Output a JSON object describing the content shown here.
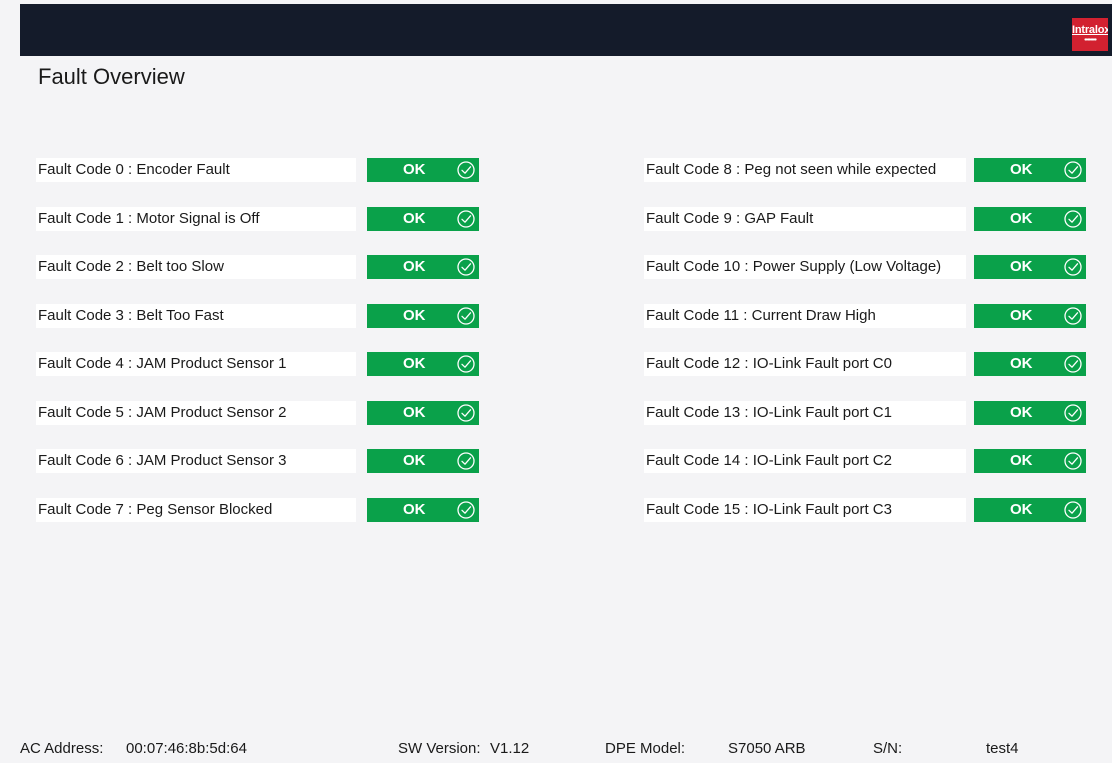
{
  "header": {
    "brand": "Intralox",
    "brand_color": "#d22130",
    "bar_color": "#141b2a"
  },
  "page": {
    "title": "Fault Overview"
  },
  "status_color": "#0aa14a",
  "status_icon": "check-circle-icon",
  "faults_left": [
    {
      "label": "Fault Code 0 : Encoder Fault",
      "status": "OK"
    },
    {
      "label": "Fault Code 1 : Motor Signal is Off",
      "status": "OK"
    },
    {
      "label": "Fault Code 2 : Belt too Slow",
      "status": "OK"
    },
    {
      "label": "Fault Code 3 : Belt Too Fast",
      "status": "OK"
    },
    {
      "label": "Fault Code 4 : JAM Product Sensor 1",
      "status": "OK"
    },
    {
      "label": "Fault Code 5 : JAM Product Sensor 2",
      "status": "OK"
    },
    {
      "label": "Fault Code 6 : JAM Product Sensor 3",
      "status": "OK"
    },
    {
      "label": "Fault Code 7 : Peg Sensor Blocked",
      "status": "OK"
    }
  ],
  "faults_right": [
    {
      "label": "Fault Code 8 : Peg not seen while expected",
      "status": "OK"
    },
    {
      "label": "Fault Code 9 : GAP Fault",
      "status": "OK"
    },
    {
      "label": "Fault Code 10 : Power Supply (Low Voltage)",
      "status": "OK"
    },
    {
      "label": "Fault Code 11 : Current Draw High",
      "status": "OK"
    },
    {
      "label": "Fault Code 12 : IO-Link Fault port C0",
      "status": "OK"
    },
    {
      "label": "Fault Code 13 : IO-Link Fault port C1",
      "status": "OK"
    },
    {
      "label": "Fault Code 14 : IO-Link Fault port C2",
      "status": "OK"
    },
    {
      "label": "Fault Code 15 : IO-Link Fault port C3",
      "status": "OK"
    }
  ],
  "footer": {
    "mac_label": "AC Address:",
    "mac_value": "00:07:46:8b:5d:64",
    "sw_label": "SW Version:",
    "sw_value": "V1.12",
    "dpe_label": "DPE Model:",
    "dpe_value": "S7050 ARB",
    "sn_label": "S/N:",
    "sn_value": "test4"
  }
}
